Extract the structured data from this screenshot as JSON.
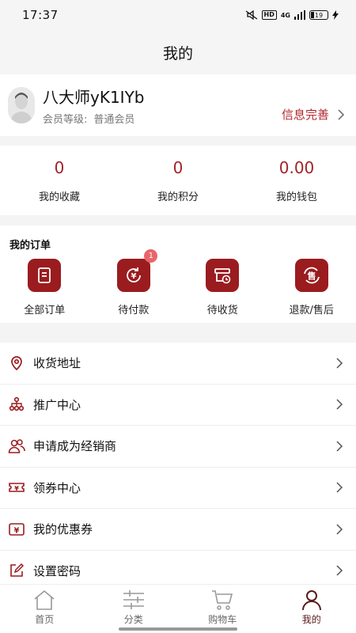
{
  "status_bar": {
    "time": "17:37",
    "hd": "HD",
    "network": "4G",
    "battery": "19"
  },
  "header": {
    "title": "我的"
  },
  "profile": {
    "name": "八大师yK1IYb",
    "level_label": "会员等级:",
    "level_value": "普通会员",
    "complete_link": "信息完善"
  },
  "stats": [
    {
      "value": "0",
      "label": "我的收藏"
    },
    {
      "value": "0",
      "label": "我的积分"
    },
    {
      "value": "0.00",
      "label": "我的钱包"
    }
  ],
  "orders": {
    "title": "我的订单",
    "items": [
      {
        "label": "全部订单",
        "icon": "document-icon"
      },
      {
        "label": "待付款",
        "icon": "yen-refresh-icon",
        "badge": "1"
      },
      {
        "label": "待收货",
        "icon": "package-clock-icon"
      },
      {
        "label": "退款/售后",
        "icon": "after-sales-icon"
      }
    ]
  },
  "menu": [
    {
      "label": "收货地址",
      "icon": "location-pin-icon"
    },
    {
      "label": "推广中心",
      "icon": "network-icon"
    },
    {
      "label": "申请成为经销商",
      "icon": "users-icon"
    },
    {
      "label": "领券中心",
      "icon": "coupon-icon"
    },
    {
      "label": "我的优惠券",
      "icon": "yen-ticket-icon"
    },
    {
      "label": "设置密码",
      "icon": "edit-icon"
    }
  ],
  "tabbar": [
    {
      "label": "首页",
      "icon": "home-icon"
    },
    {
      "label": "分类",
      "icon": "filter-icon"
    },
    {
      "label": "购物车",
      "icon": "cart-icon"
    },
    {
      "label": "我的",
      "icon": "user-icon",
      "active": true
    }
  ],
  "colors": {
    "accent": "#a32327",
    "icon_bg": "#9a1c1f",
    "badge": "#e8656a"
  }
}
